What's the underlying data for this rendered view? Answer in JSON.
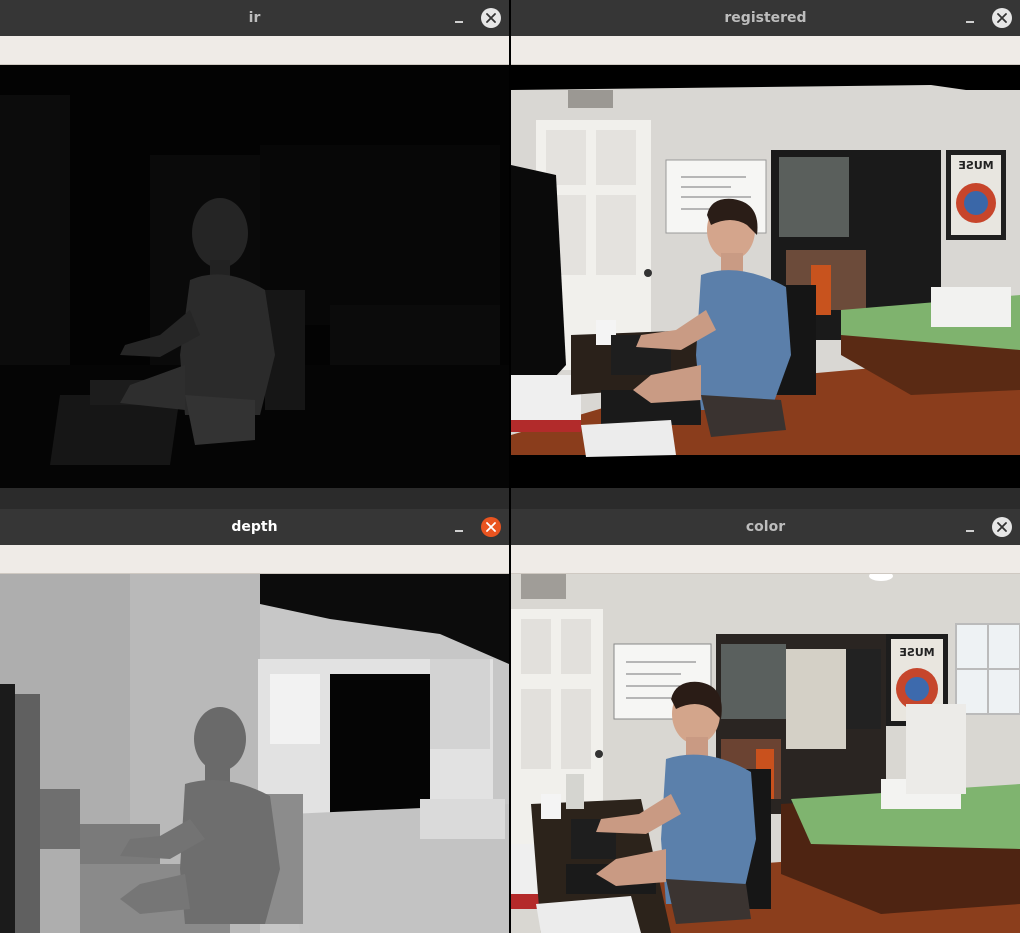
{
  "windows": {
    "ir": {
      "title": "ir",
      "active": false
    },
    "registered": {
      "title": "registered",
      "active": false
    },
    "depth": {
      "title": "depth",
      "active": true
    },
    "color": {
      "title": "color",
      "active": false
    }
  },
  "poster": {
    "text": "MUSE"
  },
  "colors": {
    "titlebar": "#363636",
    "toolbar": "#efebe7",
    "close_active": "#e95420",
    "close_inactive": "#e6e6e6"
  }
}
